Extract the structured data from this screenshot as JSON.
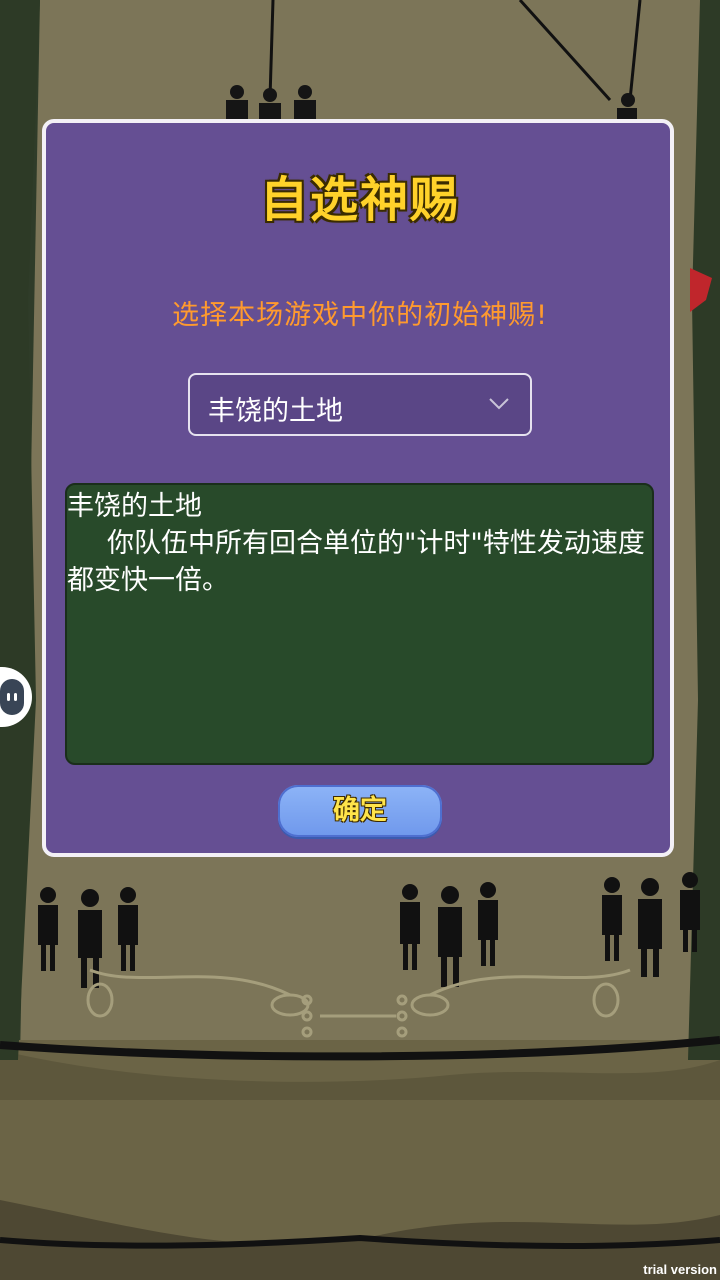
{
  "dialog": {
    "title": "自选神赐",
    "subtitle": "选择本场游戏中你的初始神赐!",
    "select": {
      "value": "丰饶的土地"
    },
    "description": {
      "title": "丰饶的土地",
      "body": "你队伍中所有回合单位的\"计时\"特性发动速度都变快一倍。"
    },
    "confirm_label": "确定"
  },
  "watermark": "trial version",
  "colors": {
    "dialog_bg": "#654f93",
    "title": "#ffd22a",
    "subtitle": "#ff9a2e",
    "desc_bg": "#284a2a",
    "button": "#7ea5f2"
  },
  "icons": [
    "chevron-down-icon",
    "side-menu-handle-icon"
  ]
}
